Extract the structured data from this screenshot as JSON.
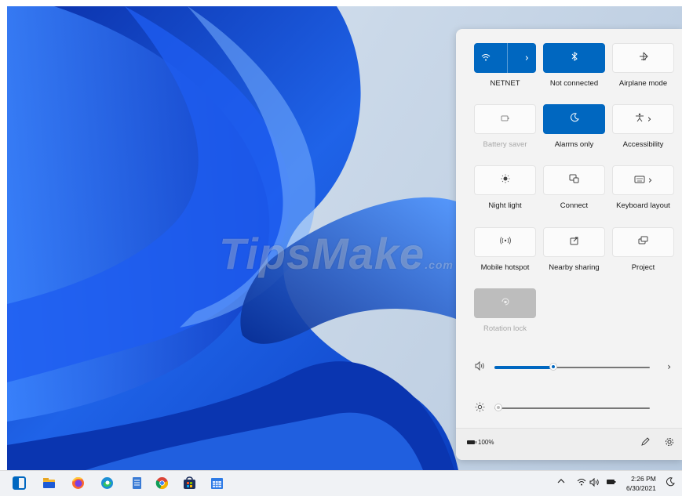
{
  "watermark": {
    "main": "TipsMake",
    "suffix": ".com"
  },
  "quick_settings": {
    "tiles": [
      {
        "label": "NETNET",
        "icon": "wifi-icon",
        "state": "on"
      },
      {
        "label": "Not connected",
        "icon": "bluetooth-icon",
        "state": "on"
      },
      {
        "label": "Airplane mode",
        "icon": "airplane-icon",
        "state": "off"
      },
      {
        "label": "Battery saver",
        "icon": "battery-saver-icon",
        "state": "disabled-label"
      },
      {
        "label": "Alarms only",
        "icon": "moon-icon",
        "state": "on"
      },
      {
        "label": "Accessibility",
        "icon": "accessibility-icon",
        "state": "off"
      },
      {
        "label": "Night light",
        "icon": "night-light-icon",
        "state": "off"
      },
      {
        "label": "Connect",
        "icon": "cast-icon",
        "state": "off"
      },
      {
        "label": "Keyboard layout",
        "icon": "keyboard-icon",
        "state": "off"
      },
      {
        "label": "Mobile hotspot",
        "icon": "hotspot-icon",
        "state": "off"
      },
      {
        "label": "Nearby sharing",
        "icon": "share-icon",
        "state": "off"
      },
      {
        "label": "Project",
        "icon": "project-icon",
        "state": "off"
      },
      {
        "label": "Rotation lock",
        "icon": "rotation-lock-icon",
        "state": "disabled"
      }
    ],
    "volume": {
      "icon": "speaker-icon",
      "value": 0.38
    },
    "brightness": {
      "icon": "sun-icon",
      "value": 0.0
    },
    "battery": {
      "percent": "100%"
    }
  },
  "taskbar": {
    "pinned": [
      "start-icon",
      "file-explorer-icon",
      "firefox-icon",
      "edge-icon",
      "notepad-icon",
      "chrome-icon",
      "store-icon",
      "calendar-icon"
    ],
    "time": "2:26 PM",
    "date": "6/30/2021"
  },
  "colors": {
    "accent": "#0067c0",
    "tile_bg": "#fbfbfb",
    "panel_bg": "#f3f3f3"
  }
}
